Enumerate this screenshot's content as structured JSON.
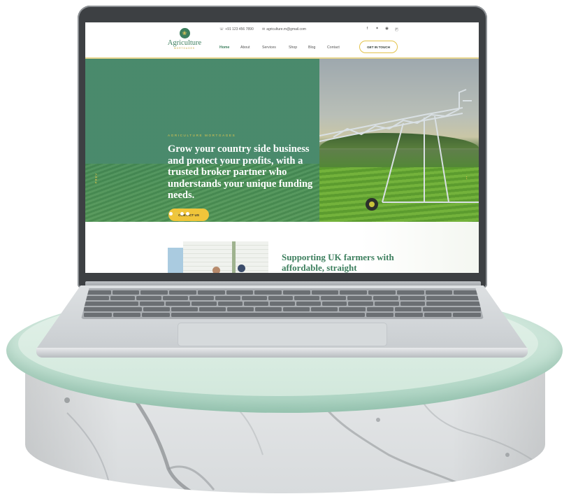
{
  "site": {
    "topbar": {
      "phone": "+91 123 456 7890",
      "email": "agriculture.m@gmail.com",
      "socials": [
        "facebook-icon",
        "twitter-icon",
        "instagram-icon",
        "pinterest-icon"
      ]
    },
    "logo": {
      "title": "Agriculture",
      "subtitle": "MORTGAGES"
    },
    "nav": [
      {
        "label": "Home",
        "active": true
      },
      {
        "label": "About",
        "active": false
      },
      {
        "label": "Services",
        "active": false
      },
      {
        "label": "Shop",
        "active": false
      },
      {
        "label": "Blog",
        "active": false
      },
      {
        "label": "Contact",
        "active": false
      }
    ],
    "cta_label": "GET IN TOUCH",
    "hero": {
      "eyebrow": "AGRICULTURE MORTGAGES",
      "heading": "Grow your country side business and protect your profits, with a trusted broker partner who understands your unique funding needs.",
      "button": "CONTACT US",
      "prev": "PREV",
      "slides": 4,
      "active_slide": 2
    },
    "section": {
      "heading": "Supporting UK farmers with affordable, straight"
    },
    "colors": {
      "brand_green": "#3d7f5e",
      "accent_gold": "#f0c53a",
      "pedestal_mint": "#c5e2d4"
    }
  }
}
